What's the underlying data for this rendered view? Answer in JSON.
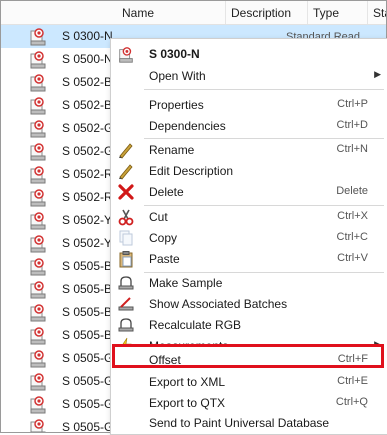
{
  "header": {
    "name": "Name",
    "description": "Description",
    "type": "Type",
    "status_partial": "Sta"
  },
  "rows": [
    {
      "label": "S 0300-N"
    },
    {
      "label": "S 0500-N"
    },
    {
      "label": "S 0502-B"
    },
    {
      "label": "S 0502-B5"
    },
    {
      "label": "S 0502-G"
    },
    {
      "label": "S 0502-G5"
    },
    {
      "label": "S 0502-R"
    },
    {
      "label": "S 0502-R5"
    },
    {
      "label": "S 0502-Y"
    },
    {
      "label": "S 0502-Y5"
    },
    {
      "label": "S 0505-B"
    },
    {
      "label": "S 0505-B2"
    },
    {
      "label": "S 0505-B5"
    },
    {
      "label": "S 0505-B8"
    },
    {
      "label": "S 0505-G"
    },
    {
      "label": "S 0505-G1"
    },
    {
      "label": "S 0505-G2"
    },
    {
      "label": "S 0505-G3"
    }
  ],
  "first_row_ghost": "Standard    Read",
  "menu": {
    "title": "S 0300-N",
    "items": {
      "open_with": "Open With",
      "properties": "Properties",
      "properties_key": "Ctrl+P",
      "dependencies": "Dependencies",
      "dependencies_key": "Ctrl+D",
      "rename": "Rename",
      "rename_key": "Ctrl+N",
      "edit_description": "Edit Description",
      "delete": "Delete",
      "delete_key": "Delete",
      "cut": "Cut",
      "cut_key": "Ctrl+X",
      "copy": "Copy",
      "copy_key": "Ctrl+C",
      "paste": "Paste",
      "paste_key": "Ctrl+V",
      "make_sample": "Make Sample",
      "show_batches": "Show Associated Batches",
      "recalc_rgb": "Recalculate RGB",
      "measurements": "Measurements",
      "offset": "Offset",
      "offset_key": "Ctrl+F",
      "export_xml": "Export to XML",
      "export_xml_key": "Ctrl+E",
      "export_qtx": "Export to QTX",
      "export_qtx_key": "Ctrl+Q",
      "send_to_db": "Send to Paint Universal Database"
    }
  },
  "colors": {
    "selection": "#cce8ff",
    "highlight_box": "#e0101c"
  }
}
